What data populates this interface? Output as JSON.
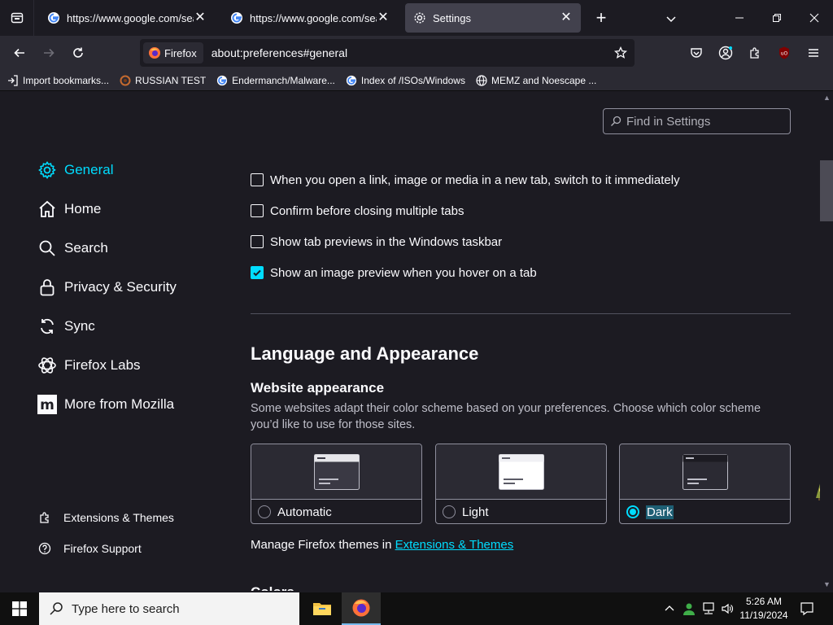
{
  "tabs": [
    {
      "title": "https://www.google.com/search",
      "favicon": "google-icon"
    },
    {
      "title": "https://www.google.com/search",
      "favicon": "google-icon"
    },
    {
      "title": "Settings",
      "favicon": "gear-icon"
    }
  ],
  "navbar": {
    "identity_label": "Firefox",
    "url": "about:preferences#general"
  },
  "bookmarks": [
    {
      "label": "Import bookmarks...",
      "icon": "import-icon"
    },
    {
      "label": "RUSSIAN TEST",
      "icon": "site-icon"
    },
    {
      "label": "Endermanch/Malware...",
      "icon": "google-icon"
    },
    {
      "label": "Index of /ISOs/Windows",
      "icon": "google-icon"
    },
    {
      "label": "MEMZ and Noescape ...",
      "icon": "globe-icon"
    }
  ],
  "search": {
    "placeholder": "Find in Settings"
  },
  "categories": [
    {
      "label": "General",
      "icon": "gear-icon",
      "selected": true
    },
    {
      "label": "Home",
      "icon": "home-icon"
    },
    {
      "label": "Search",
      "icon": "search-icon"
    },
    {
      "label": "Privacy & Security",
      "icon": "lock-icon"
    },
    {
      "label": "Sync",
      "icon": "sync-icon"
    },
    {
      "label": "Firefox Labs",
      "icon": "labs-icon"
    },
    {
      "label": "More from Mozilla",
      "icon": "mozilla-icon"
    }
  ],
  "footer_links": [
    {
      "label": "Extensions & Themes",
      "icon": "puzzle-icon"
    },
    {
      "label": "Firefox Support",
      "icon": "help-icon"
    }
  ],
  "tab_options": [
    {
      "label": "When you open a link, image or media in a new tab, switch to it immediately",
      "checked": false
    },
    {
      "label": "Confirm before closing multiple tabs",
      "checked": false
    },
    {
      "label": "Show tab previews in the Windows taskbar",
      "checked": false
    },
    {
      "label": "Show an image preview when you hover on a tab",
      "checked": true
    }
  ],
  "appearance": {
    "heading": "Language and Appearance",
    "subheading": "Website appearance",
    "description": "Some websites adapt their color scheme based on your preferences. Choose which color scheme you’d like to use for those sites.",
    "options": [
      {
        "label": "Automatic",
        "selected": false
      },
      {
        "label": "Light",
        "selected": false
      },
      {
        "label": "Dark",
        "selected": true
      }
    ],
    "manage_text": "Manage Firefox themes in ",
    "manage_link": "Extensions & Themes",
    "next_heading_partial": "Colors"
  },
  "taskbar": {
    "search_placeholder": "Type here to search",
    "time": "5:26 AM",
    "date": "11/19/2024"
  },
  "colors": {
    "accent": "#00ddff",
    "background": "#1c1b22",
    "toolbar": "#2b2a33"
  }
}
